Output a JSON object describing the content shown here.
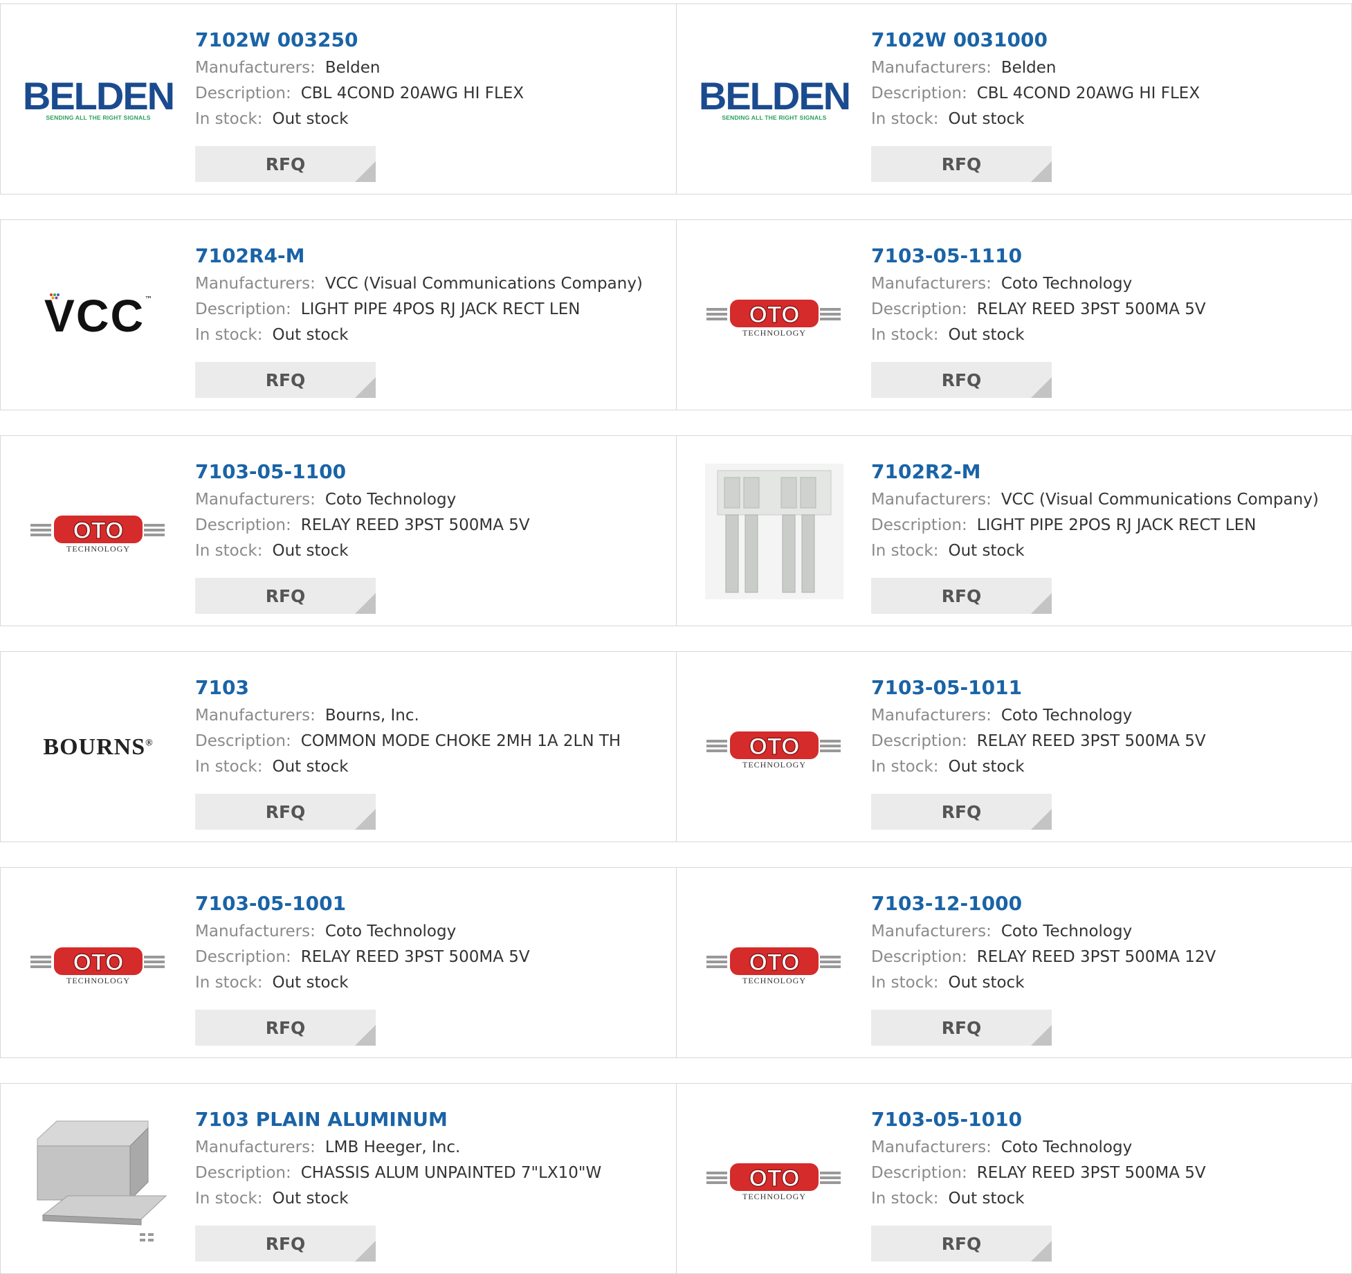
{
  "labels": {
    "manufacturers": "Manufacturers:",
    "description": "Description:",
    "in_stock": "In stock:",
    "rfq": "RFQ"
  },
  "logos": {
    "belden_word": "BELDEN",
    "belden_tag": "SENDING ALL THE RIGHT SIGNALS",
    "vcc_word": "VCC",
    "vcc_tm": "™",
    "coto_word": "OTO",
    "coto_sub": "TECHNOLOGY",
    "bourns_word": "BOURNS",
    "bourns_mark": "®"
  },
  "products": [
    {
      "part": "7102W 003250",
      "manufacturer": "Belden",
      "description": "CBL 4COND 20AWG HI FLEX",
      "stock": "Out stock",
      "logo": "belden-logo"
    },
    {
      "part": "7102W 0031000",
      "manufacturer": "Belden",
      "description": "CBL 4COND 20AWG HI FLEX",
      "stock": "Out stock",
      "logo": "belden-logo"
    },
    {
      "part": "7102R4-M",
      "manufacturer": "VCC (Visual Communications Company)",
      "description": "LIGHT PIPE 4POS RJ JACK RECT LEN",
      "stock": "Out stock",
      "logo": "vcc-logo"
    },
    {
      "part": "7103-05-1110",
      "manufacturer": "Coto Technology",
      "description": "RELAY REED 3PST 500MA 5V",
      "stock": "Out stock",
      "logo": "coto-technology-logo"
    },
    {
      "part": "7103-05-1100",
      "manufacturer": "Coto Technology",
      "description": "RELAY REED 3PST 500MA 5V",
      "stock": "Out stock",
      "logo": "coto-technology-logo"
    },
    {
      "part": "7102R2-M",
      "manufacturer": "VCC (Visual Communications Company)",
      "description": "LIGHT PIPE 2POS RJ JACK RECT LEN",
      "stock": "Out stock",
      "logo": "light-pipe-product-image"
    },
    {
      "part": "7103",
      "manufacturer": "Bourns, Inc.",
      "description": "COMMON MODE CHOKE 2MH 1A 2LN TH",
      "stock": "Out stock",
      "logo": "bourns-logo"
    },
    {
      "part": "7103-05-1011",
      "manufacturer": "Coto Technology",
      "description": "RELAY REED 3PST 500MA 5V",
      "stock": "Out stock",
      "logo": "coto-technology-logo"
    },
    {
      "part": "7103-05-1001",
      "manufacturer": "Coto Technology",
      "description": "RELAY REED 3PST 500MA 5V",
      "stock": "Out stock",
      "logo": "coto-technology-logo"
    },
    {
      "part": "7103-12-1000",
      "manufacturer": "Coto Technology",
      "description": "RELAY REED 3PST 500MA 12V",
      "stock": "Out stock",
      "logo": "coto-technology-logo"
    },
    {
      "part": "7103 PLAIN ALUMINUM",
      "manufacturer": "LMB Heeger, Inc.",
      "description": "CHASSIS ALUM UNPAINTED 7\"LX10\"W",
      "stock": "Out stock",
      "logo": "aluminum-chassis-product-image"
    },
    {
      "part": "7103-05-1010",
      "manufacturer": "Coto Technology",
      "description": "RELAY REED 3PST 500MA 5V",
      "stock": "Out stock",
      "logo": "coto-technology-logo"
    }
  ],
  "colors": {
    "part_link": "#1a63a6",
    "label_gray": "#8a8a8a",
    "value_text": "#333333",
    "rfq_bg": "#ebebeb",
    "border": "#d8d8d8",
    "coto_red": "#d52b2b"
  }
}
